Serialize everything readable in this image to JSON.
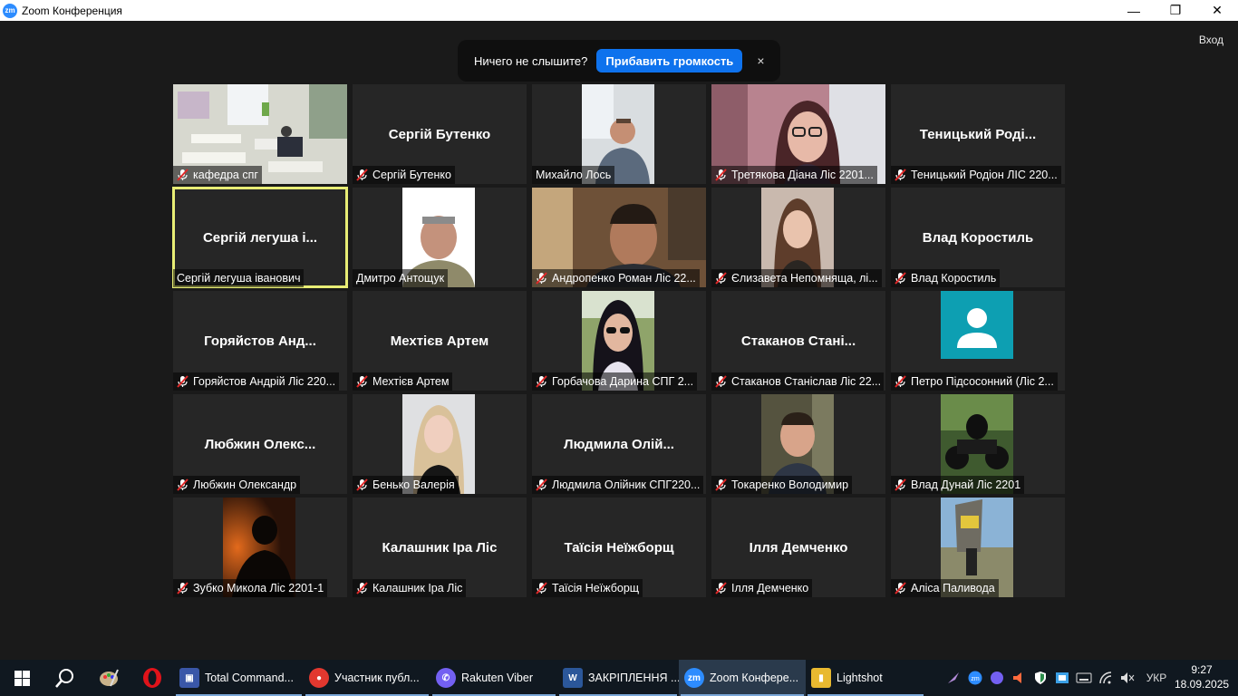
{
  "window": {
    "title": "Zoom Конференция",
    "logo_text": "zm",
    "minimize": "—",
    "restore": "❐",
    "close": "✕"
  },
  "meeting": {
    "exit_label": "Вход",
    "notice": {
      "text": "Ничего не слышите?",
      "button": "Прибавить громкость",
      "close": "×"
    },
    "tiles": [
      {
        "name": "кафедра спг",
        "muted": true,
        "video": "classroom"
      },
      {
        "name": "Сергій Бутенко",
        "display": "Сергій Бутенко",
        "muted": true
      },
      {
        "name": "Михайло Лось",
        "muted": false,
        "video": "man-office"
      },
      {
        "name": "Третякова Діана  Ліс 2201...",
        "muted": true,
        "video": "woman-glasses"
      },
      {
        "name": "Теницький Родіон ЛІС 220...",
        "display": "Теницький  Роді...",
        "muted": true
      },
      {
        "name": "Сергій легуша іванович",
        "display": "Сергій  легуша і...",
        "muted": false,
        "active": true
      },
      {
        "name": "Дмитро Антощук",
        "muted": false,
        "video": "man-white"
      },
      {
        "name": "Андропенко Роман Ліс 22...",
        "muted": true,
        "video": "man-room"
      },
      {
        "name": "Єлизавета Непомняща, лі...",
        "muted": true,
        "video": "young-woman"
      },
      {
        "name": "Влад Коростиль",
        "display": "Влад Коростиль",
        "muted": true
      },
      {
        "name": "Горяйстов Андрій Ліс 220...",
        "display": "Горяйстов  Анд...",
        "muted": true
      },
      {
        "name": "Мехтієв Артем",
        "display": "Мехтієв Артем",
        "muted": true
      },
      {
        "name": "Горбачова Дарина СПГ 2...",
        "muted": true,
        "video": "woman-sunglasses"
      },
      {
        "name": "Стаканов Станіслав Ліс 22...",
        "display": "Стаканов  Стані...",
        "muted": true
      },
      {
        "name": "Петро Підсосонний (Ліс 2...",
        "muted": true,
        "video": "avatar"
      },
      {
        "name": "Любжин Олександр",
        "display": "Любжин  Олекс...",
        "muted": true
      },
      {
        "name": "Бенько Валерія",
        "muted": true,
        "video": "blonde-woman"
      },
      {
        "name": "Людмила Олійник СПГ220...",
        "display": "Людмила  Олій...",
        "muted": true
      },
      {
        "name": "Токаренко  Володимир",
        "muted": true,
        "video": "man-portrait"
      },
      {
        "name": "Влад Дунай Ліс 2201",
        "muted": true,
        "video": "motorcycle"
      },
      {
        "name": "Зубко Микола  Ліс 2201-1",
        "muted": true,
        "video": "silhouette"
      },
      {
        "name": "Калашник Іра Ліс",
        "display": "Калашник Іра Ліс",
        "muted": true
      },
      {
        "name": "Таїсія Неїжборщ",
        "display": "Таїсія Неїжборщ",
        "muted": true
      },
      {
        "name": "Ілля Демченко",
        "display": "Ілля Демченко",
        "muted": true
      },
      {
        "name": "Аліса Паливода",
        "muted": true,
        "video": "outdoor"
      }
    ]
  },
  "taskbar": {
    "apps": [
      {
        "label": "Total Command...",
        "icon": "floppy-icon"
      },
      {
        "label": "Участник публ...",
        "icon": "chrome-icon"
      },
      {
        "label": "Rakuten Viber",
        "icon": "viber-icon"
      },
      {
        "label": "ЗАКРІПЛЕННЯ ...",
        "icon": "word-icon"
      },
      {
        "label": "Zoom Конфере...",
        "icon": "zoom-icon"
      },
      {
        "label": "Lightshot",
        "icon": "folder-icon"
      }
    ],
    "language": "УКР",
    "time": "9:27",
    "date": "18.09.2025"
  },
  "colors": {
    "accent": "#0e72ed",
    "active_speaker": "#e8ed75",
    "tile_bg": "#262626",
    "meeting_bg": "#1a1a1a",
    "taskbar_bg": "#101820"
  }
}
